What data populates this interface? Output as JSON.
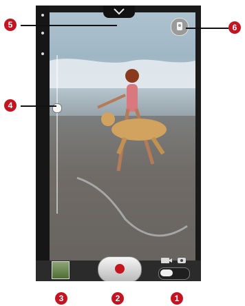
{
  "callouts": {
    "one": "1",
    "two": "2",
    "three": "3",
    "four": "4",
    "five": "5",
    "six": "6"
  },
  "icons": {
    "mode_video": "video-camera-icon",
    "mode_photo": "photo-camera-icon"
  }
}
